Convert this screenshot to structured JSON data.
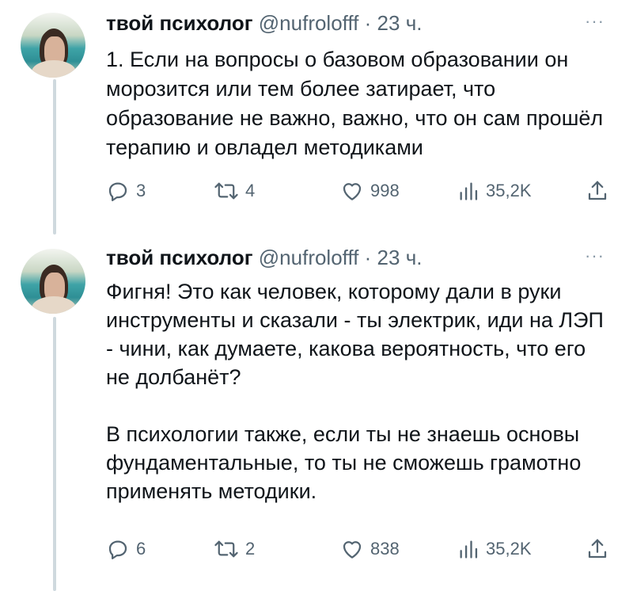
{
  "tweets": [
    {
      "author_name": "твой психолог",
      "handle": "@nufrolofff",
      "separator": "·",
      "time": "23 ч.",
      "more_label": "···",
      "text": "1. Если на вопросы о базовом образовании он морозится или тем более затирает, что образование не важно, важно, что он сам прошёл терапию и овладел методиками",
      "replies": "3",
      "retweets": "4",
      "likes": "998",
      "views": "35,2K",
      "icons": [
        "reply-icon",
        "retweet-icon",
        "like-icon",
        "views-icon",
        "share-icon"
      ]
    },
    {
      "author_name": "твой психолог",
      "handle": "@nufrolofff",
      "separator": "·",
      "time": "23 ч.",
      "more_label": "···",
      "text": "Фигня! Это как человек, которому дали в руки инструменты и сказали - ты электрик, иди на ЛЭП - чини, как думаете, какова вероятность, что его не долбанёт?\n\nВ психологии также, если ты не знаешь основы фундаментальные, то ты не сможешь грамотно применять методики.",
      "replies": "6",
      "retweets": "2",
      "likes": "838",
      "views": "35,2K",
      "icons": [
        "reply-icon",
        "retweet-icon",
        "like-icon",
        "views-icon",
        "share-icon"
      ]
    }
  ],
  "colors": {
    "text": "#0f1419",
    "secondary": "#536471",
    "thread_line": "#cfd9de",
    "background": "#ffffff"
  }
}
